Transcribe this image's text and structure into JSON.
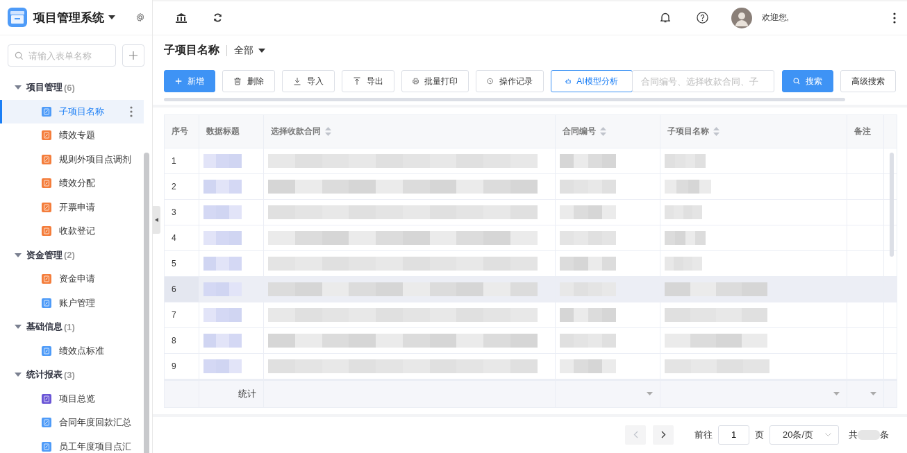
{
  "sidebar": {
    "title": "项目管理系统",
    "search": {
      "placeholder": "请输入表单名称"
    },
    "groups": [
      {
        "label": "项目管理",
        "count": "(6)",
        "expanded": true,
        "children": [
          {
            "label": "子项目名称",
            "color": "#4e9bf8",
            "selected": true
          },
          {
            "label": "绩效专题",
            "color": "#f47d3b",
            "selected": false
          },
          {
            "label": "规则外项目点调剂",
            "color": "#f47d3b",
            "selected": false
          },
          {
            "label": "绩效分配",
            "color": "#f47d3b",
            "selected": false
          },
          {
            "label": "开票申请",
            "color": "#f47d3b",
            "selected": false
          },
          {
            "label": "收款登记",
            "color": "#f47d3b",
            "selected": false
          }
        ]
      },
      {
        "label": "资金管理",
        "count": "(2)",
        "expanded": true,
        "children": [
          {
            "label": "资金申请",
            "color": "#f47d3b",
            "selected": false
          },
          {
            "label": "账户管理",
            "color": "#4e9bf8",
            "selected": false
          }
        ]
      },
      {
        "label": "基础信息",
        "count": "(1)",
        "expanded": true,
        "children": [
          {
            "label": "绩效点标准",
            "color": "#4e9bf8",
            "selected": false
          }
        ]
      },
      {
        "label": "统计报表",
        "count": "(3)",
        "expanded": true,
        "children": [
          {
            "label": "项目总览",
            "color": "#6a55d6",
            "selected": false
          },
          {
            "label": "合同年度回款汇总",
            "color": "#4e9bf8",
            "selected": false
          },
          {
            "label": "员工年度项目点汇",
            "color": "#4e9bf8",
            "selected": false
          }
        ]
      }
    ]
  },
  "header": {
    "greeting": "欢迎您,"
  },
  "page": {
    "title": "子项目名称",
    "filter": "全部"
  },
  "toolbar": {
    "buttons": [
      {
        "label": "新增",
        "kind": "primary"
      },
      {
        "label": "删除",
        "kind": "default"
      },
      {
        "label": "导入",
        "kind": "default"
      },
      {
        "label": "导出",
        "kind": "default"
      },
      {
        "label": "批量打印",
        "kind": "default"
      },
      {
        "label": "操作记录",
        "kind": "default"
      },
      {
        "label": "AI模型分析",
        "kind": "outline"
      }
    ],
    "search": {
      "placeholder": "合同编号、选择收款合同、子"
    },
    "search_button": "搜索",
    "advanced_button": "高级搜索"
  },
  "table": {
    "columns": [
      {
        "label": "序号",
        "sortable": false,
        "footer_filter": false
      },
      {
        "label": "数据标题",
        "sortable": false,
        "footer_filter": false
      },
      {
        "label": "选择收款合同",
        "sortable": true,
        "footer_filter": false
      },
      {
        "label": "合同编号",
        "sortable": true,
        "footer_filter": true
      },
      {
        "label": "子项目名称",
        "sortable": true,
        "footer_filter": true
      },
      {
        "label": "备注",
        "sortable": false,
        "footer_filter": true
      }
    ],
    "rows": [
      {
        "index": "1",
        "highlighted": false
      },
      {
        "index": "2",
        "highlighted": false
      },
      {
        "index": "3",
        "highlighted": false
      },
      {
        "index": "4",
        "highlighted": false
      },
      {
        "index": "5",
        "highlighted": false
      },
      {
        "index": "6",
        "highlighted": true
      },
      {
        "index": "7",
        "highlighted": false
      },
      {
        "index": "8",
        "highlighted": false
      },
      {
        "index": "9",
        "highlighted": false
      }
    ],
    "footer_label": "统计"
  },
  "pagination": {
    "goto_label": "前往",
    "page": "1",
    "page_unit": "页",
    "page_size": "20条/页",
    "total_prefix": "共",
    "total_suffix": "条"
  }
}
